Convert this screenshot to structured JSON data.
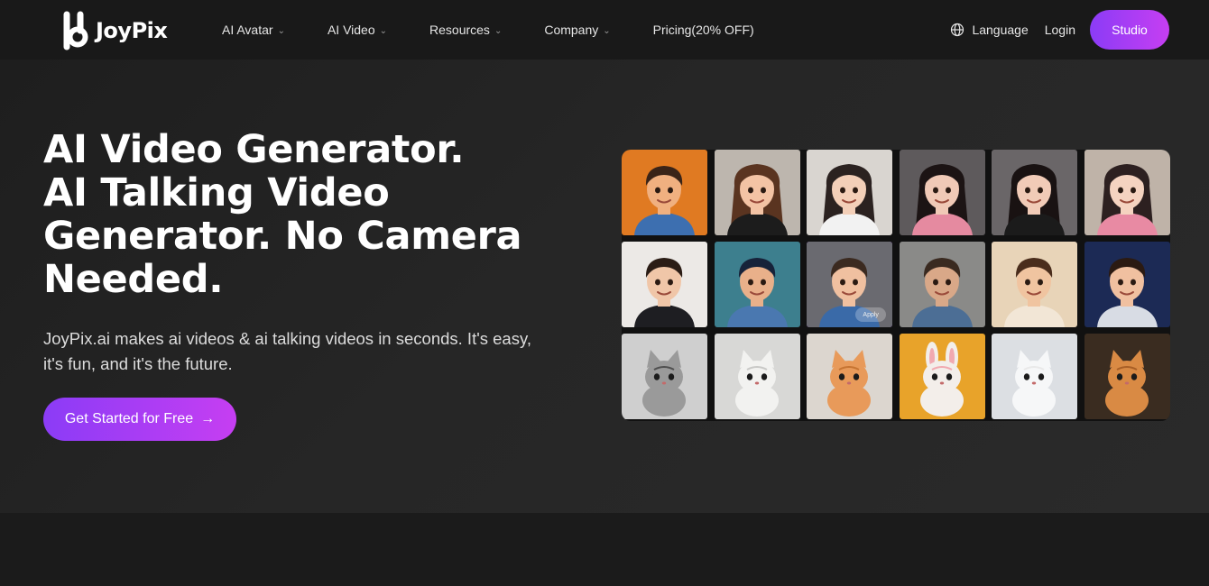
{
  "nav": {
    "logo_text": "JoyPix",
    "menu": [
      {
        "label": "AI Avatar",
        "dropdown": true
      },
      {
        "label": "AI Video",
        "dropdown": true
      },
      {
        "label": "Resources",
        "dropdown": true
      },
      {
        "label": "Company",
        "dropdown": true
      },
      {
        "label": "Pricing(20% OFF)",
        "dropdown": false
      }
    ],
    "language_label": "Language",
    "login_label": "Login",
    "studio_label": "Studio"
  },
  "hero": {
    "title_lines": [
      "AI Video Generator.",
      "AI Talking Video",
      "Generator. No Camera",
      "Needed."
    ],
    "subtitle_lines": [
      "JoyPix.ai makes ai videos & ai talking videos in seconds. It's easy,",
      "it's fun, and it's the future."
    ],
    "cta_label": "Get Started for Free",
    "cta_arrow": "→"
  },
  "avatars": [
    {
      "kind": "cartoon-boy",
      "bg": "#e07a22",
      "skin": "#f0b080",
      "hair": "#3a2418",
      "shirt": "#3d6fb0"
    },
    {
      "kind": "cartoon-girl",
      "bg": "#bdb6ae",
      "skin": "#f3c3a4",
      "hair": "#5a3420",
      "shirt": "#1c1c1c"
    },
    {
      "kind": "woman-blazer",
      "bg": "#d9d5d0",
      "skin": "#f3cfb8",
      "hair": "#2b2220",
      "shirt": "#f2f2f2"
    },
    {
      "kind": "woman-dark",
      "bg": "#5e5a5c",
      "skin": "#f0c9b6",
      "hair": "#1c1414",
      "shirt": "#e58aa0"
    },
    {
      "kind": "woman-dark-2",
      "bg": "#6a6668",
      "skin": "#f1cbb7",
      "hair": "#191212",
      "shirt": "#1b1b1b"
    },
    {
      "kind": "woman-light",
      "bg": "#bfb3a8",
      "skin": "#f5d3c0",
      "hair": "#2d2020",
      "shirt": "#e88aa3"
    },
    {
      "kind": "man-suit",
      "bg": "#ece9e6",
      "skin": "#f0c6a8",
      "hair": "#2b1d16",
      "shirt": "#1e1e22"
    },
    {
      "kind": "man-teal",
      "bg": "#3d7f8e",
      "skin": "#e9b08a",
      "hair": "#17233a",
      "shirt": "#4a78b0"
    },
    {
      "kind": "boy-selected",
      "bg": "#6a6a70",
      "skin": "#f0c0a0",
      "hair": "#3b2a20",
      "shirt": "#3a6aa8"
    },
    {
      "kind": "man-beard",
      "bg": "#8a8a88",
      "skin": "#d9a888",
      "hair": "#3a2a20",
      "shirt": "#4c6e95"
    },
    {
      "kind": "boy-leaves",
      "bg": "#e8d4b8",
      "skin": "#f0c4a0",
      "hair": "#4a2d1c",
      "shirt": "#f2e6d6"
    },
    {
      "kind": "astronaut",
      "bg": "#1c2a55",
      "skin": "#f0c0a0",
      "hair": "#2b1a12",
      "shirt": "#d8dce4"
    },
    {
      "kind": "kitten-gray",
      "bg": "#cfcfcf",
      "fur": "#9a9a9a",
      "accent": "#4f4f4f"
    },
    {
      "kind": "cat-white",
      "bg": "#d8d8d6",
      "fur": "#f2f2f0",
      "accent": "#c9c9c7"
    },
    {
      "kind": "kitten-orange",
      "bg": "#dcd6cf",
      "fur": "#e89a5a",
      "accent": "#c67432"
    },
    {
      "kind": "bunny",
      "bg": "#e8a32a",
      "fur": "#f3eeea",
      "accent": "#f1a9b0"
    },
    {
      "kind": "cat-cartoon-white",
      "bg": "#dcdfe3",
      "fur": "#f6f7f8",
      "accent": "#e9e9e9"
    },
    {
      "kind": "cat-orange-dark",
      "bg": "#3a2c20",
      "fur": "#d98a44",
      "accent": "#a85f26"
    }
  ],
  "grid": {
    "apply_label": "Apply"
  },
  "colors": {
    "accent_start": "#8b3cf6",
    "accent_end": "#c63ef2",
    "nav_bg": "#191919",
    "hero_bg": "#232323"
  }
}
